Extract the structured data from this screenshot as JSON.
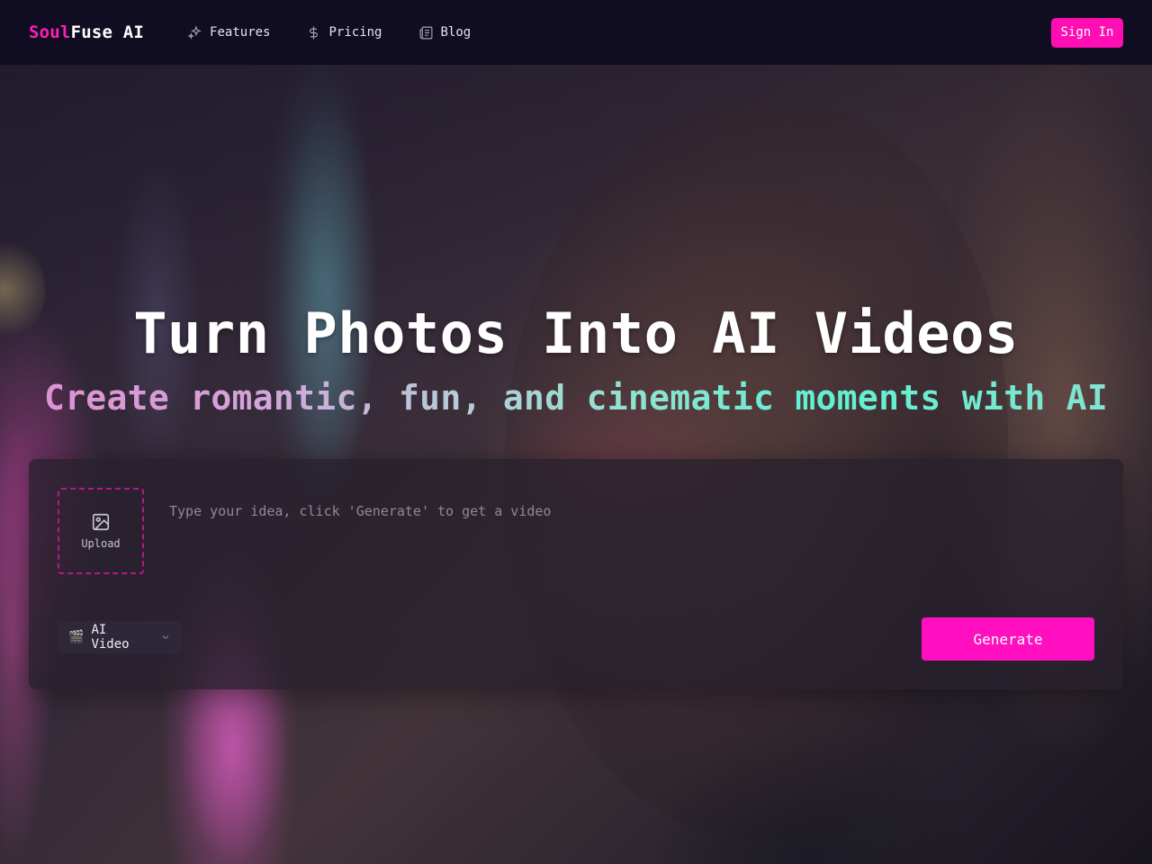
{
  "brand": {
    "soul": "Soul",
    "rest": "Fuse AI",
    "accent": "#ff1fb6"
  },
  "nav": {
    "items": [
      {
        "label": "Features",
        "icon": "sparkles-icon"
      },
      {
        "label": "Pricing",
        "icon": "dollar-icon"
      },
      {
        "label": "Blog",
        "icon": "newspaper-icon"
      }
    ],
    "signin_label": "Sign In"
  },
  "hero": {
    "title": "Turn Photos Into AI Videos",
    "subtitle": "Create romantic, fun, and cinematic moments with AI"
  },
  "panel": {
    "upload_label": "Upload",
    "prompt_placeholder": "Type your idea, click 'Generate' to get a video",
    "mode_icon": "🎬",
    "mode_label": "AI Video",
    "generate_label": "Generate"
  },
  "colors": {
    "primary": "#ff0fc0",
    "navbar_bg": "#100d22"
  }
}
